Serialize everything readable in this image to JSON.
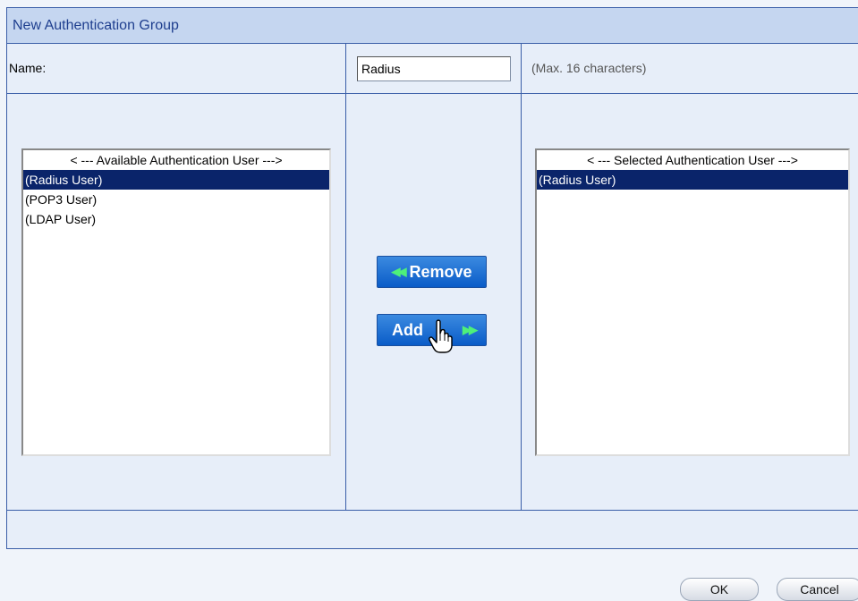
{
  "window": {
    "title": "New Authentication Group"
  },
  "name_row": {
    "label": "Name:",
    "value": "Radius",
    "hint": "(Max. 16 characters)"
  },
  "available_list": {
    "header": "< --- Available Authentication User --->",
    "items": [
      "(Radius User)",
      "(POP3 User)",
      "(LDAP User)"
    ],
    "selected": "(Radius User)"
  },
  "selected_list": {
    "header": "< --- Selected Authentication User --->",
    "items": [
      "(Radius User)"
    ],
    "selected": "(Radius User)"
  },
  "buttons": {
    "remove": "Remove",
    "add": "Add",
    "ok": "OK",
    "cancel": "Cancel"
  },
  "icons": {
    "remove_arrows": "double-left-arrow-icon",
    "add_arrows": "double-right-arrow-icon",
    "cursor": "hand-pointer-icon"
  },
  "colors": {
    "selection": "#0a246a",
    "border": "#3a5ea8",
    "button_blue": "#0a5cc8",
    "arrow_green": "#4ef07a"
  }
}
